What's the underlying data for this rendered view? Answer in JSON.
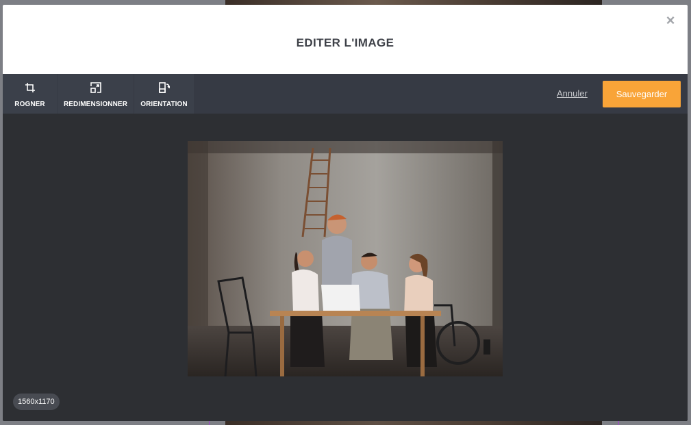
{
  "modal": {
    "title": "EDITER L'IMAGE",
    "close_label": "×"
  },
  "toolbar": {
    "tools": [
      {
        "label": "ROGNER",
        "icon": "crop-icon"
      },
      {
        "label": "REDIMENSIONNER",
        "icon": "resize-icon"
      },
      {
        "label": "ORIENTATION",
        "icon": "rotate-icon"
      }
    ],
    "cancel_label": "Annuler",
    "save_label": "Sauvegarder"
  },
  "image": {
    "alt": "Quatre personnes autour d'une table devant un ordinateur portable",
    "dimensions": "1560x1170"
  },
  "colors": {
    "accent": "#f9a438",
    "toolbar": "#363a44",
    "canvas": "#2d2f33"
  }
}
